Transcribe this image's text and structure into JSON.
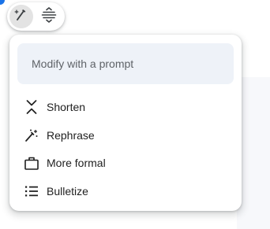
{
  "colors": {
    "accent": "#1a73e8",
    "input_bg": "#eef2f8",
    "active_tool_bg": "#e3e3e3",
    "text": "#1f1f1f",
    "placeholder": "#5f6368"
  },
  "toolbar": {
    "buttons": [
      {
        "icon": "magic-pen-icon",
        "active": true
      },
      {
        "icon": "text-spacing-icon",
        "active": false
      }
    ]
  },
  "panel": {
    "prompt": {
      "placeholder": "Modify with a prompt",
      "value": ""
    },
    "items": [
      {
        "icon": "shorten-icon",
        "label": "Shorten"
      },
      {
        "icon": "sparkle-wand-icon",
        "label": "Rephrase"
      },
      {
        "icon": "briefcase-icon",
        "label": "More formal"
      },
      {
        "icon": "bulleted-list-icon",
        "label": "Bulletize"
      }
    ]
  }
}
